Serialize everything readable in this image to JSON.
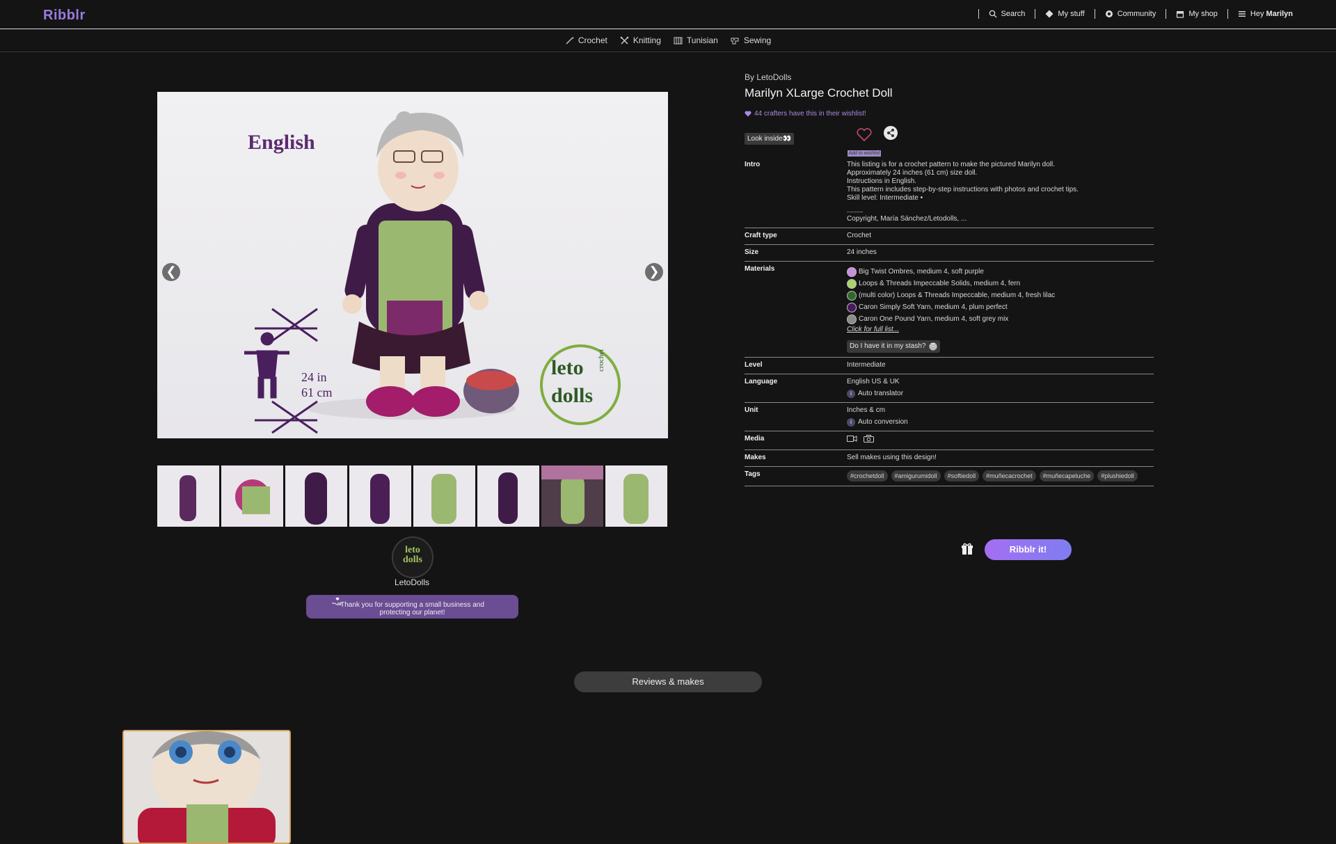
{
  "header": {
    "logo": "Ribblr",
    "nav": [
      {
        "label": "Search",
        "icon": "search-icon"
      },
      {
        "label": "My stuff",
        "icon": "diamond-icon"
      },
      {
        "label": "Community",
        "icon": "chat-icon"
      },
      {
        "label": "My shop",
        "icon": "shop-icon"
      }
    ],
    "greeting_prefix": "Hey",
    "user_name": "Marilyn"
  },
  "crafts": [
    {
      "label": "Crochet",
      "icon": "crochet-hook-icon"
    },
    {
      "label": "Knitting",
      "icon": "knitting-needles-icon"
    },
    {
      "label": "Tunisian",
      "icon": "tunisian-icon"
    },
    {
      "label": "Sewing",
      "icon": "sewing-machine-icon"
    }
  ],
  "gallery": {
    "main_image_text": "English",
    "measure_in": "24 in",
    "measure_cm": "61 cm",
    "logo_top": "leto",
    "logo_bottom": "dolls",
    "logo_side": "crochet",
    "prev": "❮",
    "next": "❯",
    "thumbnail_count": 8
  },
  "shop": {
    "avatar_text": "leto dolls",
    "name": "LetoDolls",
    "thanks": "Thank you for supporting a small business and protecting our planet!"
  },
  "reviews_label": "Reviews & makes",
  "product": {
    "byline": "By LetoDolls",
    "title": "Marilyn XLarge Crochet Doll",
    "wishlist_count_text": "44 crafters have this in their wishlist!",
    "look_inside": "Look inside👀",
    "add_to_wishlist": "Add to wishlist",
    "intro_label": "Intro",
    "intro_lines": [
      "This listing is for a crochet pattern to make the pictured Marilyn doll.",
      "Approximately 24 inches (61 cm) size doll.",
      "Instructions in English.",
      "This pattern includes step-by-step instructions with photos and crochet tips.",
      "Skill level: Intermediate •",
      "",
      "----------",
      "Copyright, María Sánchez/Letodolls, ..."
    ],
    "craft_type_label": "Craft type",
    "craft_type": "Crochet",
    "size_label": "Size",
    "size": "24 inches",
    "materials_label": "Materials",
    "materials": [
      {
        "name": "Big Twist Ombres, medium 4, soft purple",
        "color": "#c98fe0"
      },
      {
        "name": "Loops & Threads Impeccable Solids, medium 4, fern",
        "color": "#a9d46a"
      },
      {
        "name": "(multi color) Loops & Threads Impeccable, medium 4, fresh lilac",
        "color": "#2e6b2a"
      },
      {
        "name": "Caron Simply Soft Yarn, medium 4, plum perfect",
        "color": "#4a1a5e"
      },
      {
        "name": "Caron One Pound Yarn, medium 4, soft grey mix",
        "color": "#8a8a8a"
      }
    ],
    "full_list": "Click for full list...",
    "stash_btn": "Do I have it in my stash?",
    "level_label": "Level",
    "level": "Intermediate",
    "language_label": "Language",
    "language": "English US & UK",
    "auto_translator": "Auto translator",
    "unit_label": "Unit",
    "unit": "Inches & cm",
    "auto_conversion": "Auto conversion",
    "media_label": "Media",
    "makes_label": "Makes",
    "makes": "Sell makes using this design!",
    "tags_label": "Tags",
    "tags": [
      "#crochetdoll",
      "#amigurumidoll",
      "#softiedoll",
      "#muñecacrochet",
      "#muñecapeluche",
      "#plushiedoll"
    ],
    "ribblr_it": "Ribblr it!"
  }
}
